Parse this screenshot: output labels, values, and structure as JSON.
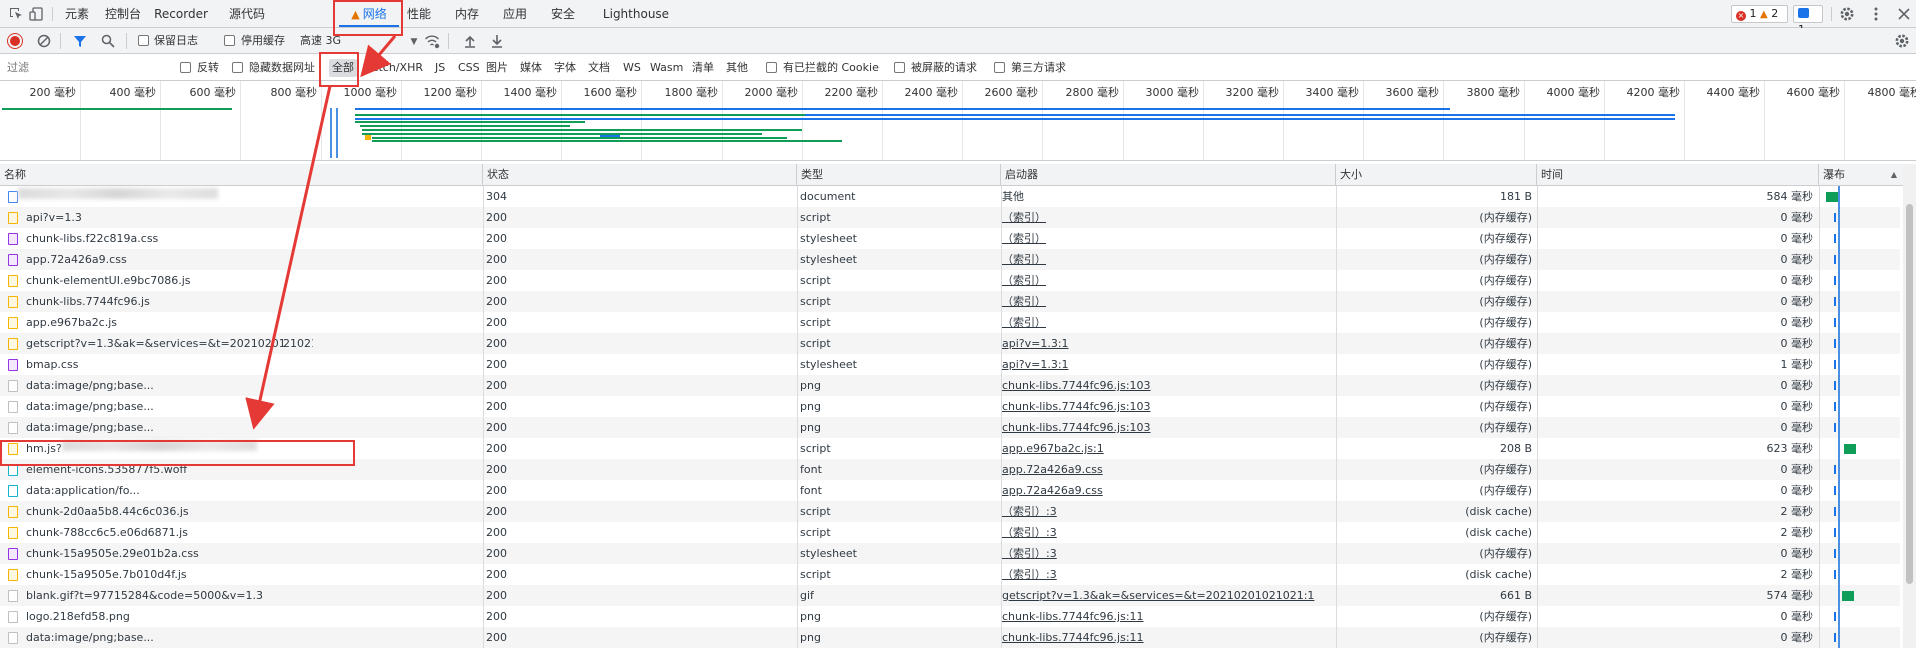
{
  "tabs": {
    "items": [
      "元素",
      "控制台",
      "Recorder",
      "源代码",
      "网络",
      "性能",
      "内存",
      "应用",
      "安全",
      "Lighthouse"
    ],
    "active": "网络"
  },
  "counters": {
    "errors": "1",
    "warnings": "2",
    "messages": "1"
  },
  "toolbar": {
    "preserve_log": "保留日志",
    "disable_cache": "停用缓存",
    "throttle": "高速 3G"
  },
  "filter": {
    "placeholder": "过滤",
    "invert": "反转",
    "hide_data_urls": "隐藏数据网址",
    "types": [
      "全部",
      "Fetch/XHR",
      "JS",
      "CSS",
      "图片",
      "媒体",
      "字体",
      "文档",
      "WS",
      "Wasm",
      "清单",
      "其他"
    ],
    "blocked_cookies": "有已拦截的 Cookie",
    "blocked_requests": "被屏蔽的请求",
    "third_party": "第三方请求"
  },
  "overview": {
    "ticks": [
      "200 毫秒",
      "400 毫秒",
      "600 毫秒",
      "800 毫秒",
      "1000 毫秒",
      "1200 毫秒",
      "1400 毫秒",
      "1600 毫秒",
      "1800 毫秒",
      "2000 毫秒",
      "2200 毫秒",
      "2400 毫秒",
      "2600 毫秒",
      "2800 毫秒",
      "3000 毫秒",
      "3200 毫秒",
      "3400 毫秒",
      "3600 毫秒",
      "3800 毫秒",
      "4000 毫秒",
      "4200 毫秒",
      "4400 毫秒",
      "4600 毫秒",
      "4800 毫秒"
    ]
  },
  "columns": {
    "name": "名称",
    "status": "状态",
    "type": "类型",
    "initiator": "启动器",
    "size": "大小",
    "time": "时间",
    "waterfall": "瀑布"
  },
  "rows": [
    {
      "name": "",
      "status": "304",
      "type": "document",
      "initiator": "其他",
      "size": "181 B",
      "time": "584 毫秒",
      "icon": "document-icon"
    },
    {
      "name": "api?v=1.3",
      "status": "200",
      "type": "script",
      "initiator": "（索引）",
      "size": "(内存缓存)",
      "time": "0 毫秒",
      "icon": "script-icon"
    },
    {
      "name": "chunk-libs.f22c819a.css",
      "status": "200",
      "type": "stylesheet",
      "initiator": "（索引）",
      "size": "(内存缓存)",
      "time": "0 毫秒",
      "icon": "stylesheet-icon"
    },
    {
      "name": "app.72a426a9.css",
      "status": "200",
      "type": "stylesheet",
      "initiator": "（索引）",
      "size": "(内存缓存)",
      "time": "0 毫秒",
      "icon": "stylesheet-icon"
    },
    {
      "name": "chunk-elementUI.e9bc7086.js",
      "status": "200",
      "type": "script",
      "initiator": "（索引）",
      "size": "(内存缓存)",
      "time": "0 毫秒",
      "icon": "script-icon"
    },
    {
      "name": "chunk-libs.7744fc96.js",
      "status": "200",
      "type": "script",
      "initiator": "（索引）",
      "size": "(内存缓存)",
      "time": "0 毫秒",
      "icon": "script-icon"
    },
    {
      "name": "app.e967ba2c.js",
      "status": "200",
      "type": "script",
      "initiator": "（索引）",
      "size": "(内存缓存)",
      "time": "0 毫秒",
      "icon": "script-icon"
    },
    {
      "name": "getscript?v=1.3&ak=&services=&t=20210201",
      "name_tail": "21021",
      "status": "200",
      "type": "script",
      "initiator": "api?v=1.3:1",
      "size": "(内存缓存)",
      "time": "0 毫秒",
      "icon": "script-icon"
    },
    {
      "name": "bmap.css",
      "status": "200",
      "type": "stylesheet",
      "initiator": "api?v=1.3:1",
      "size": "(内存缓存)",
      "time": "1 毫秒",
      "icon": "stylesheet-icon"
    },
    {
      "name": "data:image/png;base...",
      "status": "200",
      "type": "png",
      "initiator": "chunk-libs.7744fc96.js:103",
      "size": "(内存缓存)",
      "time": "0 毫秒",
      "icon": "image-icon"
    },
    {
      "name": "data:image/png;base...",
      "status": "200",
      "type": "png",
      "initiator": "chunk-libs.7744fc96.js:103",
      "size": "(内存缓存)",
      "time": "0 毫秒",
      "icon": "image-icon"
    },
    {
      "name": "data:image/png;base...",
      "status": "200",
      "type": "png",
      "initiator": "chunk-libs.7744fc96.js:103",
      "size": "(内存缓存)",
      "time": "0 毫秒",
      "icon": "image-icon"
    },
    {
      "name": "hm.js?",
      "status": "200",
      "type": "script",
      "initiator": "app.e967ba2c.js:1",
      "size": "208 B",
      "time": "623 毫秒",
      "icon": "script-icon"
    },
    {
      "name": "element-icons.535877f5.woff",
      "status": "200",
      "type": "font",
      "initiator": "app.72a426a9.css",
      "size": "(内存缓存)",
      "time": "0 毫秒",
      "icon": "font-icon"
    },
    {
      "name": "data:application/fo...",
      "status": "200",
      "type": "font",
      "initiator": "app.72a426a9.css",
      "size": "(内存缓存)",
      "time": "0 毫秒",
      "icon": "font-icon"
    },
    {
      "name": "chunk-2d0aa5b8.44c6c036.js",
      "status": "200",
      "type": "script",
      "initiator": "（索引）:3",
      "size": "(disk cache)",
      "time": "2 毫秒",
      "icon": "script-icon"
    },
    {
      "name": "chunk-788cc6c5.e06d6871.js",
      "status": "200",
      "type": "script",
      "initiator": "（索引）:3",
      "size": "(disk cache)",
      "time": "2 毫秒",
      "icon": "script-icon"
    },
    {
      "name": "chunk-15a9505e.29e01b2a.css",
      "status": "200",
      "type": "stylesheet",
      "initiator": "（索引）:3",
      "size": "(内存缓存)",
      "time": "0 毫秒",
      "icon": "stylesheet-icon"
    },
    {
      "name": "chunk-15a9505e.7b010d4f.js",
      "status": "200",
      "type": "script",
      "initiator": "（索引）:3",
      "size": "(disk cache)",
      "time": "2 毫秒",
      "icon": "script-icon"
    },
    {
      "name": "blank.gif?t=97715284&code=5000&v=1.3",
      "status": "200",
      "type": "gif",
      "initiator": "getscript?v=1.3&ak=&services=&t=20210201021021:1",
      "size": "661 B",
      "time": "574 毫秒",
      "icon": "image-icon"
    },
    {
      "name": "logo.218efd58.png",
      "status": "200",
      "type": "png",
      "initiator": "chunk-libs.7744fc96.js:11",
      "size": "(内存缓存)",
      "time": "0 毫秒",
      "icon": "image-icon"
    },
    {
      "name": "data:image/png;base...",
      "status": "200",
      "type": "png",
      "initiator": "chunk-libs.7744fc96.js:11",
      "size": "(内存缓存)",
      "time": "0 毫秒",
      "icon": "image-icon"
    }
  ],
  "colors": {
    "accent": "#1a73e8",
    "annotation": "#e53935",
    "script": "#f4b400",
    "stylesheet": "#9334e6",
    "document": "#4285f4",
    "font": "#12b5cb",
    "image": "#c0c0c0",
    "waterfall_green": "#0f9d58"
  }
}
